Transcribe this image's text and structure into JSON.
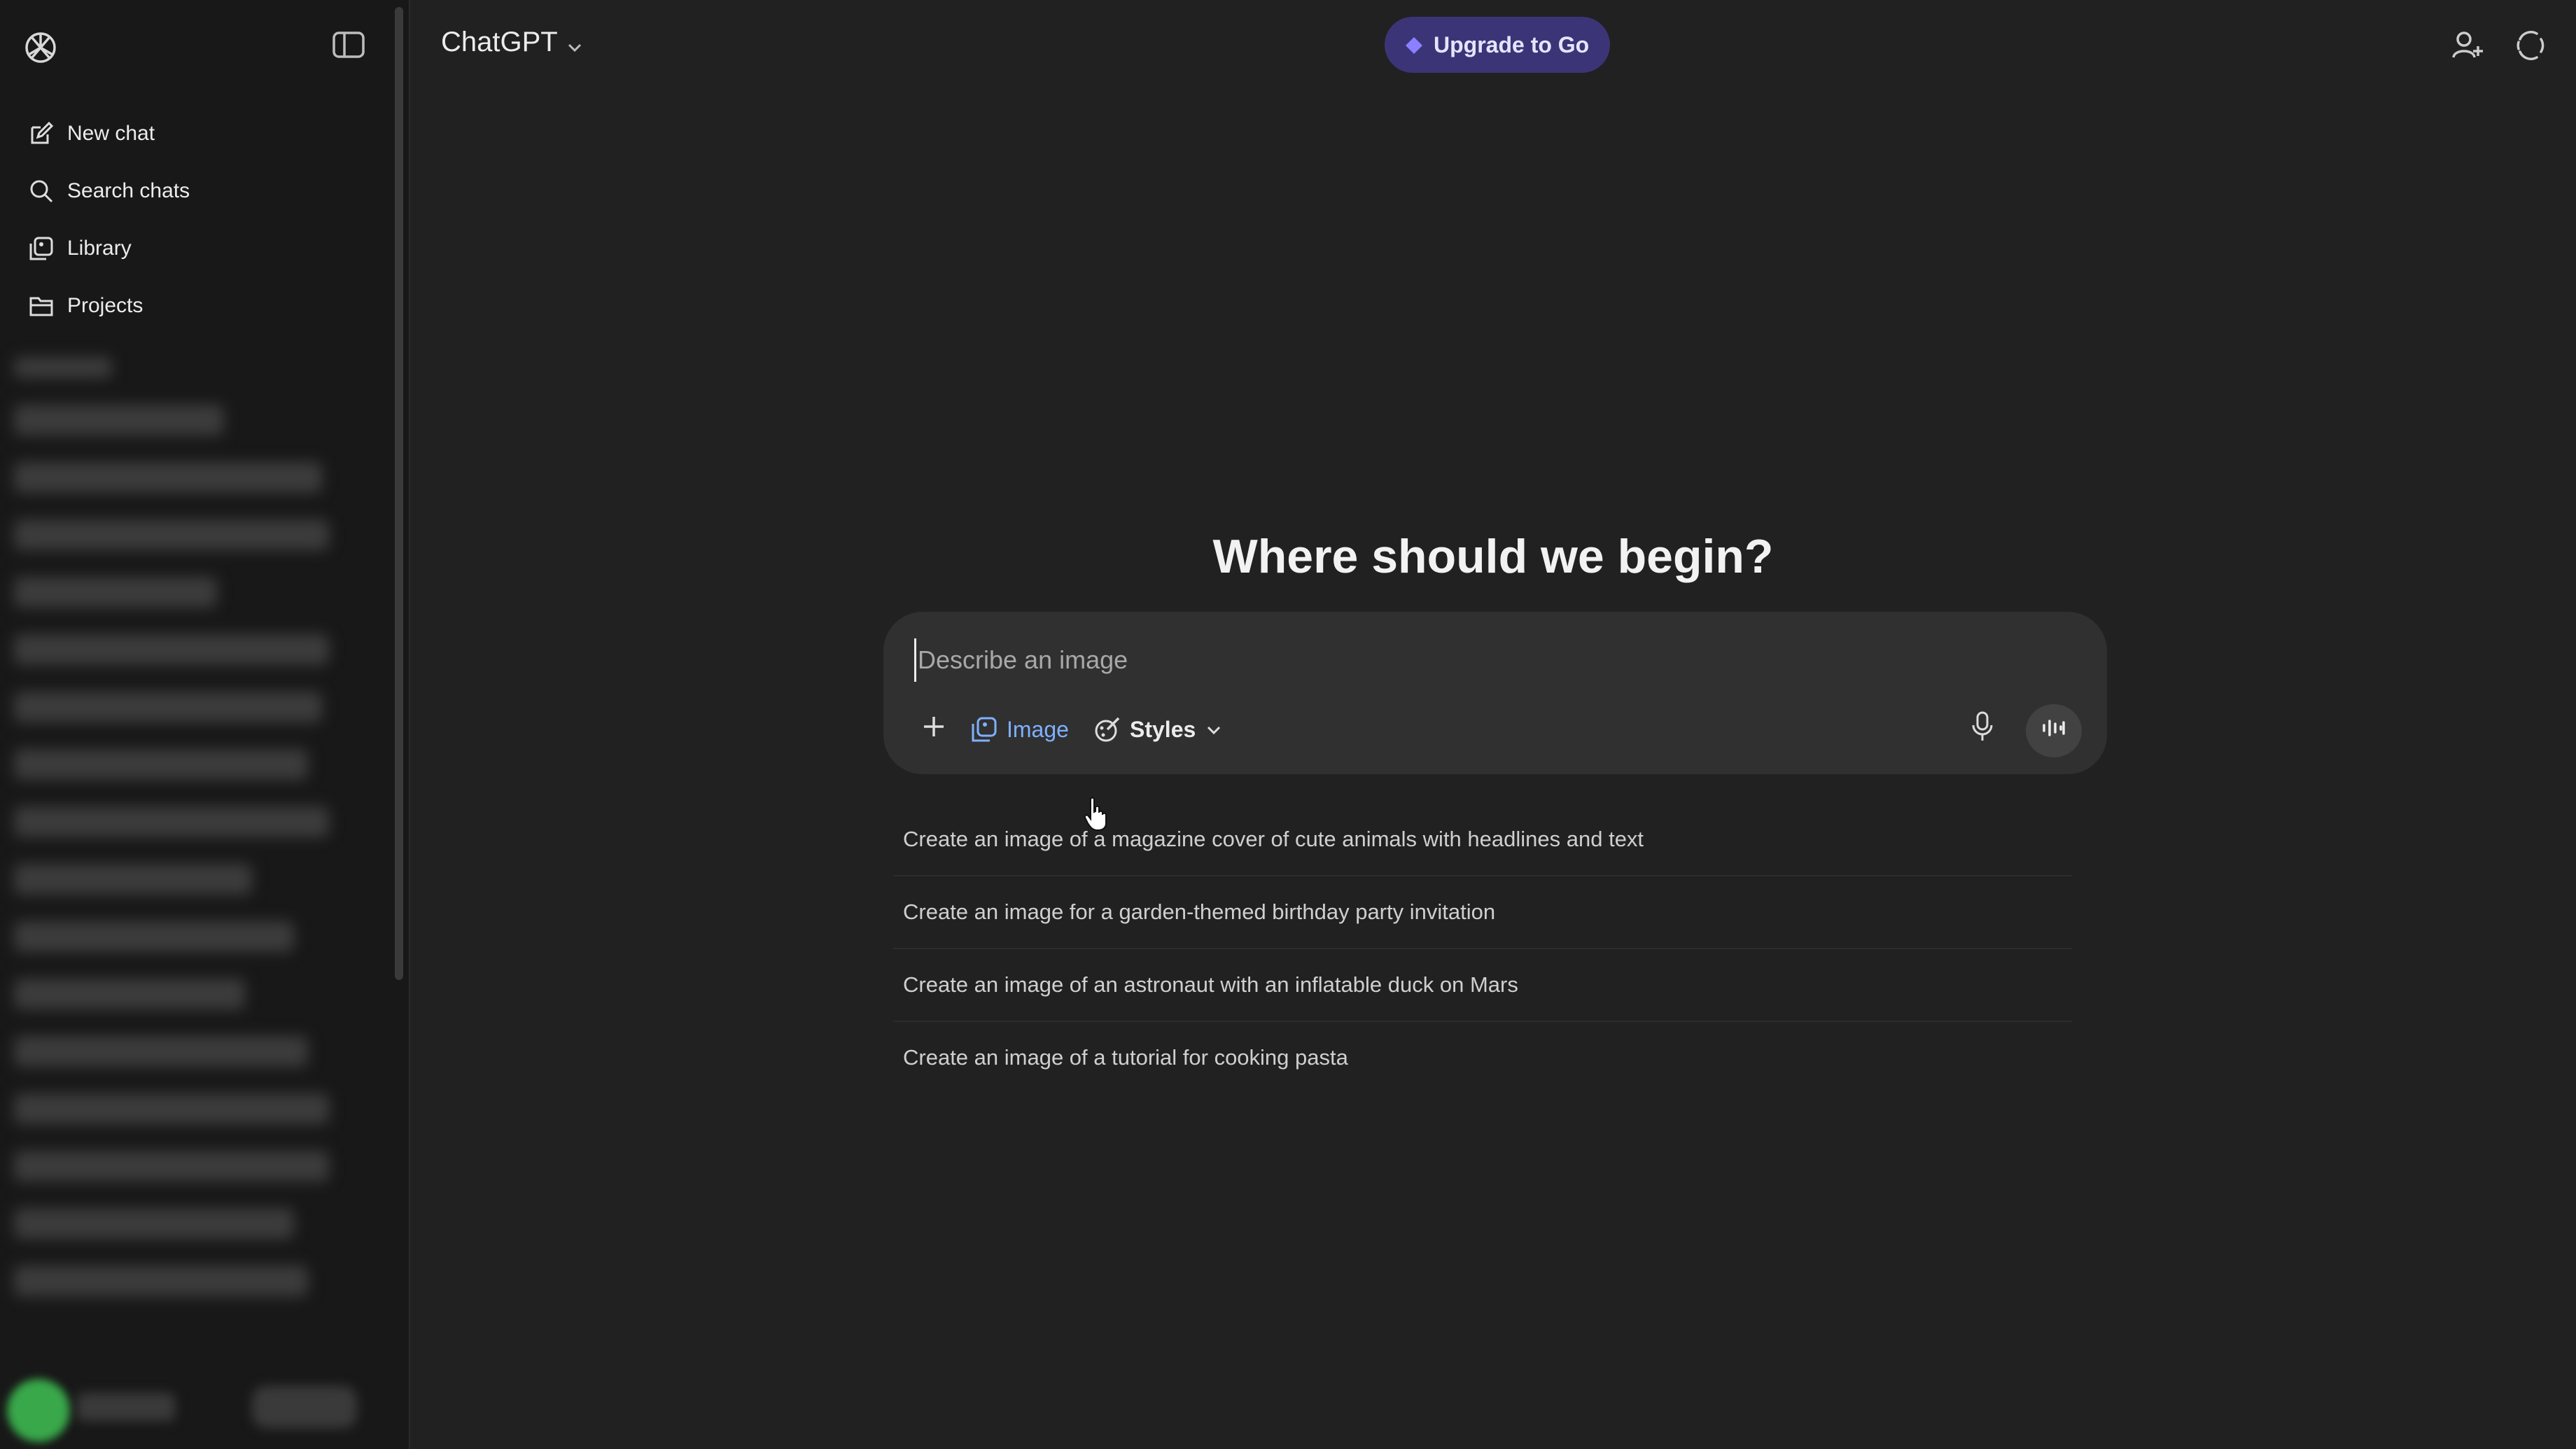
{
  "header": {
    "model_label": "ChatGPT",
    "upgrade_label": "Upgrade to Go",
    "upgrade_color": "#3b3577"
  },
  "sidebar": {
    "items": [
      {
        "label": "New chat",
        "icon": "new-chat-icon"
      },
      {
        "label": "Search chats",
        "icon": "search-icon"
      },
      {
        "label": "Library",
        "icon": "library-icon"
      },
      {
        "label": "Projects",
        "icon": "projects-icon"
      }
    ]
  },
  "main": {
    "headline": "Where should we begin?",
    "composer": {
      "placeholder": "Describe an image",
      "image_label": "Image",
      "styles_label": "Styles",
      "accent": "#7fb0ff"
    },
    "suggestions": [
      "Create an image of a magazine cover of cute animals with headlines and text",
      "Create an image for a garden-themed birthday party invitation",
      "Create an image of an astronaut with an inflatable duck on Mars",
      "Create an image of a tutorial for cooking pasta"
    ]
  }
}
